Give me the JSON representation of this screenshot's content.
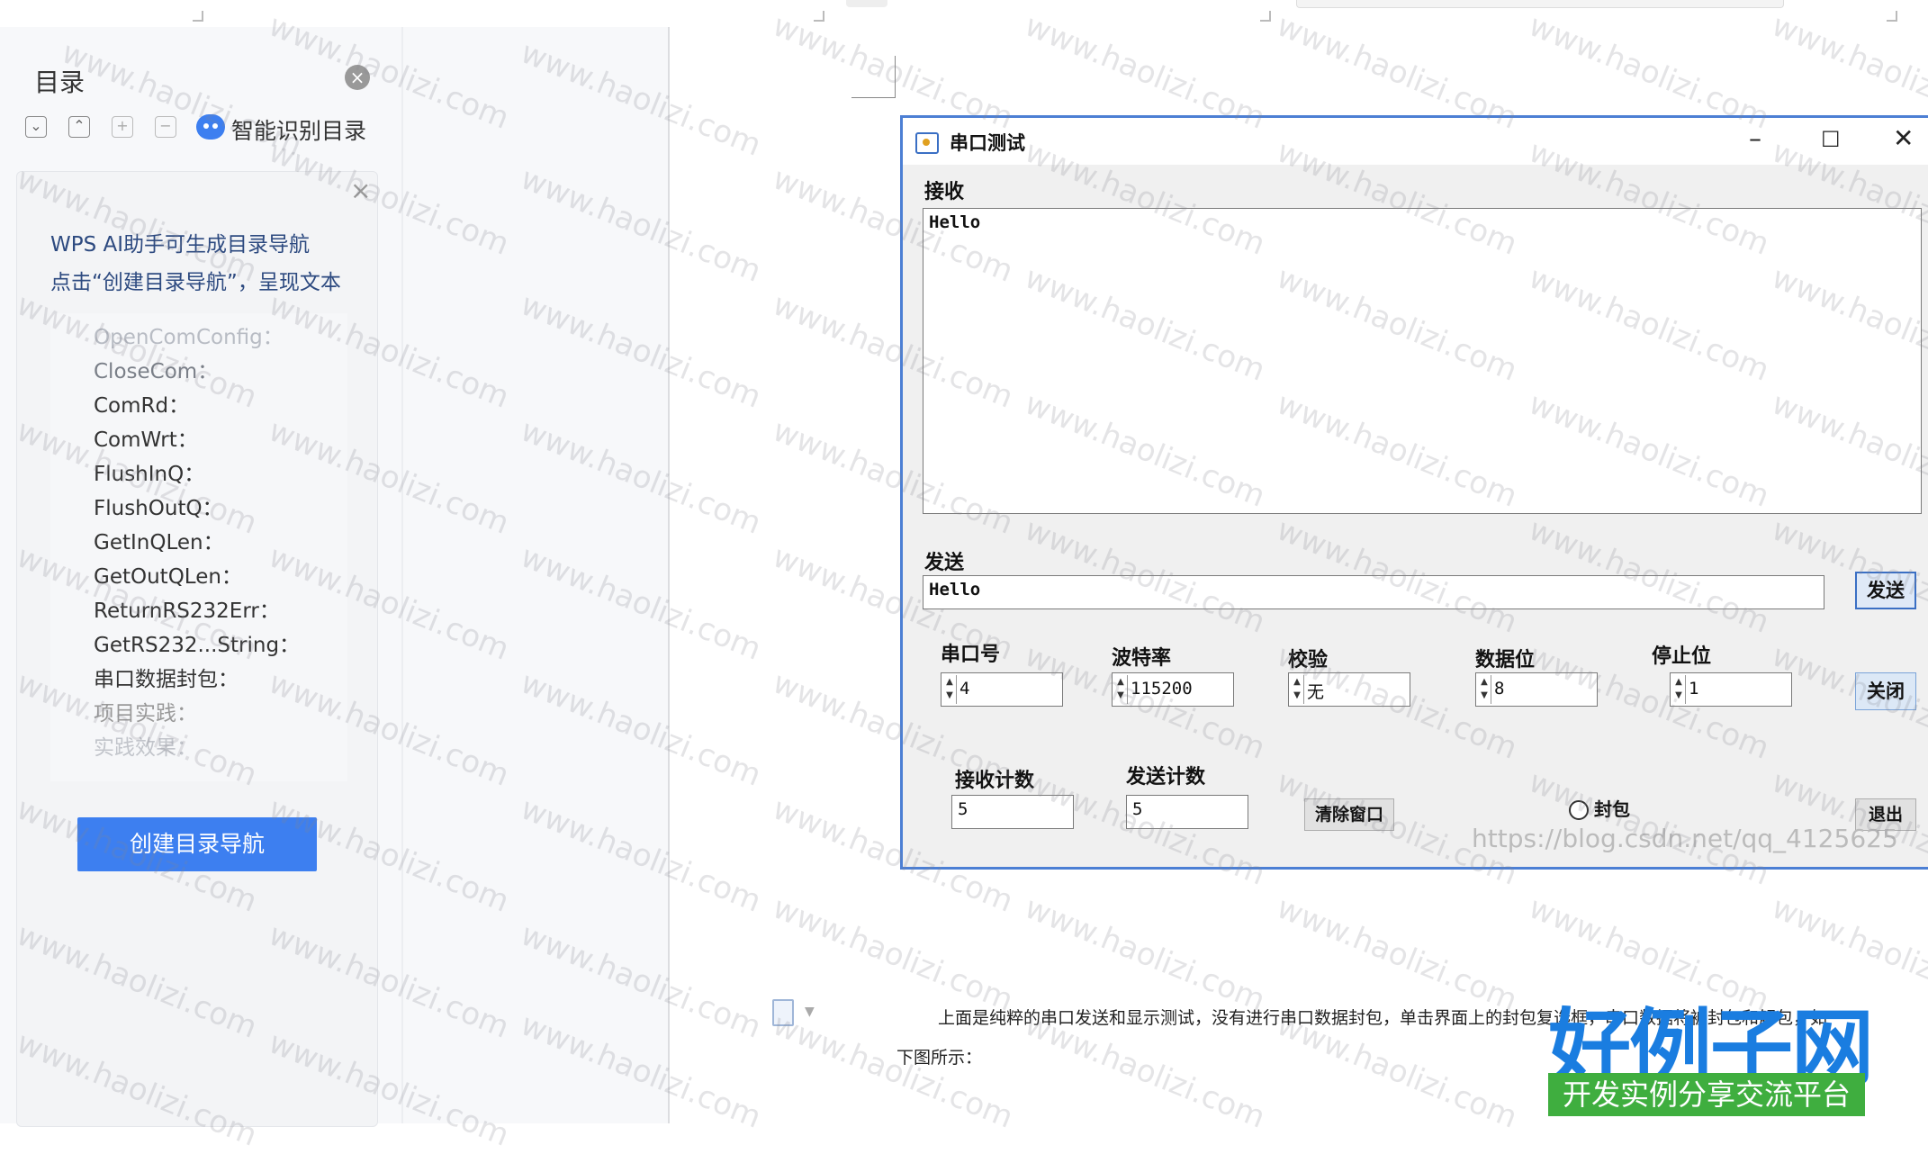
{
  "sidebar": {
    "title": "目录",
    "ai_button_label": "智能识别目录",
    "tool_plus": "+",
    "tool_minus": "−",
    "prompt_line1": "WPS AI助手可生成目录导航",
    "prompt_line2": "点击“创建目录导航”，呈现文本",
    "toc_items": [
      "OpenComConfig：",
      "CloseCom：",
      "ComRd：",
      "ComWrt：",
      "FlushInQ：",
      "FlushOutQ：",
      "GetInQLen：",
      "GetOutQLen：",
      "ReturnRS232Err：",
      "GetRS232...String：",
      "串口数据封包：",
      "项目实践：",
      "实践效果："
    ],
    "create_button": "创建目录导航"
  },
  "app_window": {
    "title": "串口测试",
    "receive_label": "接收",
    "receive_text": "Hello",
    "send_label": "发送",
    "send_text": "Hello",
    "send_button": "发送",
    "port_label": "串口号",
    "port_value": "4",
    "baud_label": "波特率",
    "baud_value": "115200",
    "parity_label": "校验",
    "parity_value": "无",
    "databits_label": "数据位",
    "databits_value": "8",
    "stopbits_label": "停止位",
    "stopbits_value": "1",
    "close_button": "关闭",
    "recv_count_label": "接收计数",
    "recv_count_value": "5",
    "send_count_label": "发送计数",
    "send_count_value": "5",
    "clear_button": "清除窗口",
    "packet_label": "封包",
    "exit_button": "退出",
    "blog_watermark": "https://blog.csdn.net/qq_4125625"
  },
  "document": {
    "para1": "上面是纯粹的串口发送和显示测试，没有进行串口数据封包，单击界面上的封包复选框，串口数据将被封包和解包，如",
    "para2": "下图所示："
  },
  "watermark": "www.haolizi.com",
  "brand": {
    "logo_text": "好例子网",
    "logo_sub": "开发实例分享交流平台"
  },
  "colors": {
    "accent": "#3d7ff0",
    "window_border": "#4c7fd4",
    "logo_blue": "#1a7de0",
    "logo_green": "#3fae3f"
  }
}
